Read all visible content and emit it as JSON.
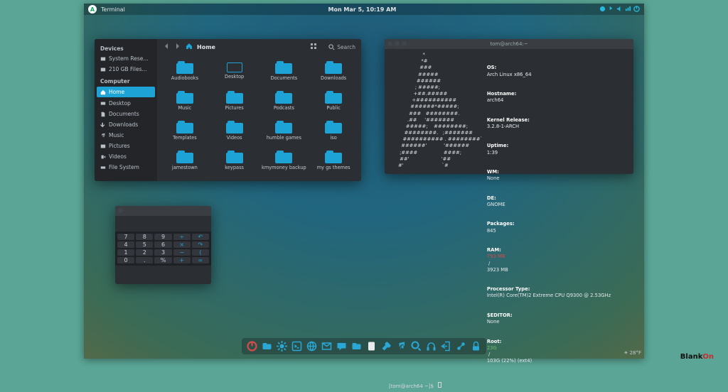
{
  "topbar": {
    "app": "Terminal",
    "clock": "Mon Mar  5, 10:19 AM"
  },
  "filemgr": {
    "crumb": "Home",
    "search_label": "Search",
    "sidebar": {
      "sections": [
        {
          "title": "Devices",
          "items": [
            "System Rese...",
            "210 GB Files..."
          ]
        },
        {
          "title": "Computer",
          "items": [
            "Home",
            "Desktop",
            "Documents",
            "Downloads",
            "Music",
            "Pictures",
            "Videos",
            "File System"
          ]
        }
      ],
      "selected": "Home"
    },
    "folders": [
      "Audiobooks",
      "Desktop",
      "Documents",
      "Downloads",
      "Music",
      "Pictures",
      "Podcasts",
      "Public",
      "Templates",
      "Videos",
      "humble games",
      "iso",
      "jamestown",
      "keypass",
      "kmymoney backup",
      "my gs themes"
    ]
  },
  "terminal": {
    "title": "tom@arch64:~",
    "ascii": "                      *\n                     *#\n                    ###\n                   #####          \n                  ######         \n                 ; #####;        \n                +##.#####        \n               +##########      \n              ######*#####;     \n             ###   ########.    \n            .##     '#######    \n           #####;    ########;  \n          ########.   ;#######  \n         ########## . ########`\n        ######'           '######\n       ;####                 ####;\n       ##'                     '##\n      #'                         `#",
    "info": {
      "OS": "Arch Linux x86_64",
      "Hostname": "arch64",
      "Kernel Release": "3.2.8-1-ARCH",
      "Uptime": "1:39",
      "WM": "None",
      "DE": "GNOME",
      "Packages": "845",
      "RAM_used": "793 MB",
      "RAM_total": "3923 MB",
      "Processor Type": "Intel(R) Core(TM)2 Extreme CPU Q9300 @ 2.53GHz",
      "$EDITOR": "None",
      "Root_used": "23G",
      "Root_rest": "103G (22%) (ext4)"
    },
    "prompt": "[tom@arch64 ~]$"
  },
  "calculator": {
    "buttons": [
      [
        "7",
        "8",
        "9",
        "÷",
        "↶"
      ],
      [
        "4",
        "5",
        "6",
        "×",
        "↷"
      ],
      [
        "1",
        "2",
        "3",
        "−",
        "("
      ],
      [
        "0",
        ".",
        "%",
        "+",
        "="
      ]
    ],
    "ops": [
      "÷",
      "×",
      "−",
      "+",
      "(",
      "↶",
      "↷",
      "="
    ]
  },
  "dock": {
    "items": [
      "power",
      "files",
      "settings",
      "terminal",
      "web",
      "mail",
      "chat",
      "folder",
      "editor",
      "wrench",
      "music",
      "search",
      "headphones",
      "logout",
      "network",
      "lock"
    ]
  },
  "weather": "28°F",
  "brand": "BlankOn"
}
